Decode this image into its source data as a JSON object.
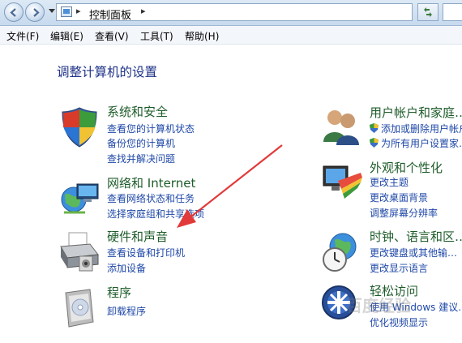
{
  "address_bar": {
    "separator": "▸",
    "breadcrumb": "控制面板"
  },
  "menu": [
    "文件(F)",
    "编辑(E)",
    "查看(V)",
    "工具(T)",
    "帮助(H)"
  ],
  "heading": "调整计算机的设置",
  "categories": [
    {
      "title": "系统和安全",
      "links": [
        "查看您的计算机状态",
        "备份您的计算机",
        "查找并解决问题"
      ]
    },
    {
      "title": "网络和 Internet",
      "links": [
        "查看网络状态和任务",
        "选择家庭组和共享选项"
      ]
    },
    {
      "title": "硬件和声音",
      "links": [
        "查看设备和打印机",
        "添加设备"
      ]
    },
    {
      "title": "程序",
      "links": [
        "卸载程序"
      ]
    },
    {
      "title": "用户帐户和家庭…",
      "links": [
        "添加或删除用户帐户",
        "为所有用户设置家…"
      ]
    },
    {
      "title": "外观和个性化",
      "links": [
        "更改主题",
        "更改桌面背景",
        "调整屏幕分辨率"
      ]
    },
    {
      "title": "时钟、语言和区…",
      "links": [
        "更改键盘或其他输…",
        "更改显示语言"
      ]
    },
    {
      "title": "轻松访问",
      "links": [
        "使用 Windows 建议…",
        "优化视频显示"
      ]
    }
  ],
  "annotation": {
    "color": "#e23a3a"
  },
  "colors": {
    "category_title": "#1e5c2a",
    "link": "#1f48a8",
    "heading": "#1e3287"
  },
  "watermark": "百度经验"
}
